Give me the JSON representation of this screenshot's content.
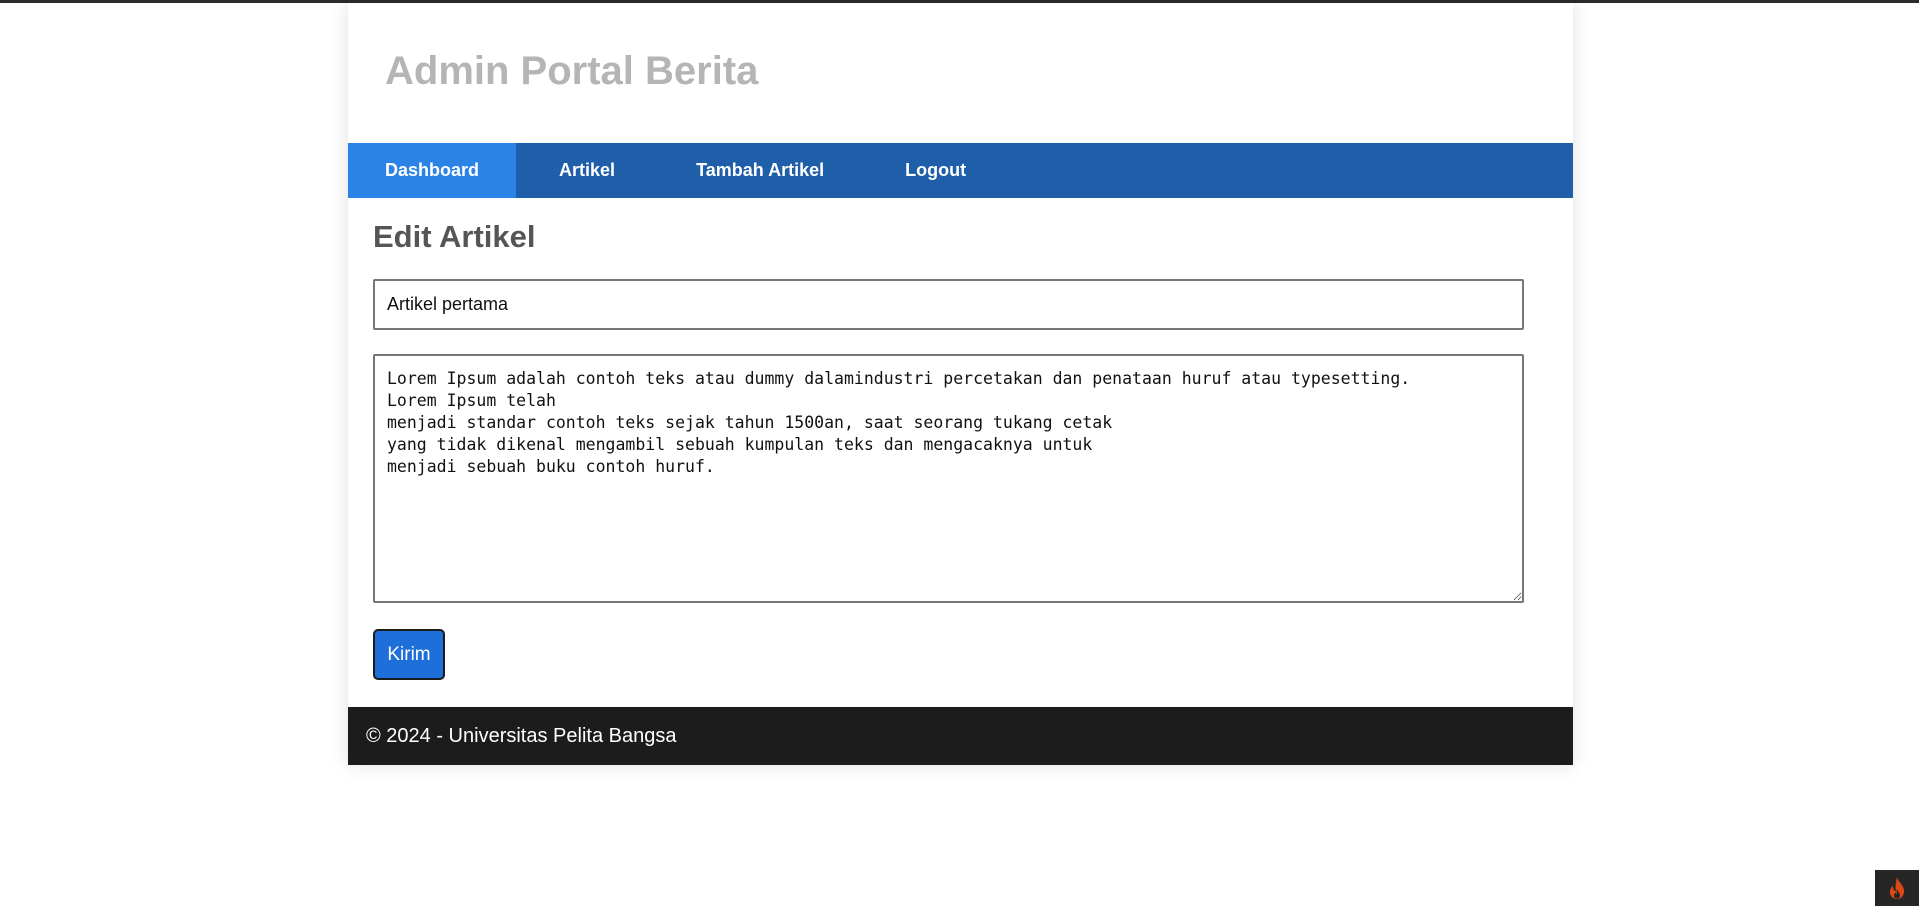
{
  "header": {
    "title": "Admin Portal Berita"
  },
  "nav": {
    "items": [
      {
        "label": "Dashboard",
        "active": true
      },
      {
        "label": "Artikel",
        "active": false
      },
      {
        "label": "Tambah Artikel",
        "active": false
      },
      {
        "label": "Logout",
        "active": false
      }
    ]
  },
  "form": {
    "heading": "Edit Artikel",
    "title_value": "Artikel pertama",
    "content_value": "Lorem Ipsum adalah contoh teks atau dummy dalamindustri percetakan dan penataan huruf atau typesetting.\nLorem Ipsum telah\nmenjadi standar contoh teks sejak tahun 1500an, saat seorang tukang cetak\nyang tidak dikenal mengambil sebuah kumpulan teks dan mengacaknya untuk\nmenjadi sebuah buku contoh huruf.",
    "submit_label": "Kirim"
  },
  "footer": {
    "text": "© 2024 - Universitas Pelita Bangsa"
  },
  "debug_toolbar": {
    "icon": "flame-icon"
  },
  "colors": {
    "nav_bg": "#1f5fa9",
    "nav_active": "#2b83e5",
    "button": "#1e6fd9",
    "footer_bg": "#1c1c1c",
    "title_gray": "#b5b5b5",
    "flame": "#dd4814"
  }
}
